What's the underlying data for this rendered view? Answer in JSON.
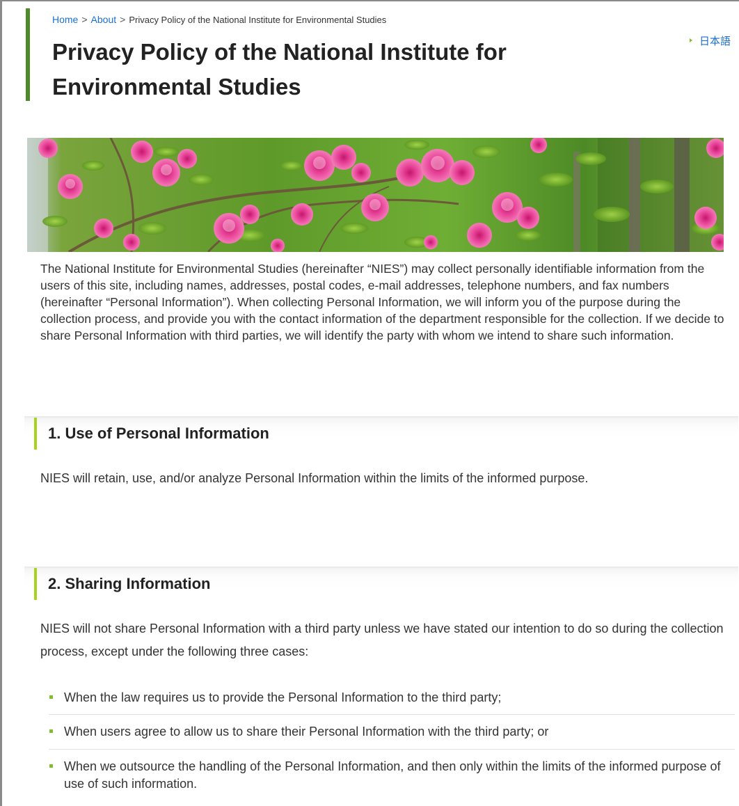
{
  "breadcrumb": {
    "home": "Home",
    "sep1": ">",
    "about": "About",
    "sep2": ">",
    "current": "Privacy Policy of the National Institute for Environmental Studies"
  },
  "language_link": "日本語",
  "page_title": "Privacy Policy of the National Institute for Environmental Studies",
  "intro": "The National Institute for Environmental Studies (hereinafter “NIES”) may collect personally identifiable information from the users of this site, including names, addresses, postal codes, e-mail addresses, telephone numbers, and fax numbers (hereinafter “Personal Information”). When collecting Personal Information, we will inform you of the purpose during the collection process, and provide you with the contact information of the department responsible for the collection. If we decide to share Personal Information with third parties, we will identify the party with whom we intend to share such information.",
  "sections": [
    {
      "heading": "1. Use of Personal Information",
      "body": "NIES will retain, use, and/or analyze Personal Information within the limits of the informed purpose."
    },
    {
      "heading": "2. Sharing Information",
      "body": "NIES will not share Personal Information with a third party unless we have stated our intention to do so during the collection process, except under the following three cases:",
      "items": [
        "When the law requires us to provide the Personal Information to the third party;",
        "When users agree to allow us to share their Personal Information with the third party; or",
        "When we outsource the handling of the Personal Information, and then only within the limits of the informed purpose of use of such information."
      ]
    }
  ],
  "colors": {
    "link": "#1a6fd1",
    "title_bar": "#4f8a2b",
    "section_bar": "#a6d41c",
    "bullet": "#7fbf2f",
    "text": "#333333"
  }
}
